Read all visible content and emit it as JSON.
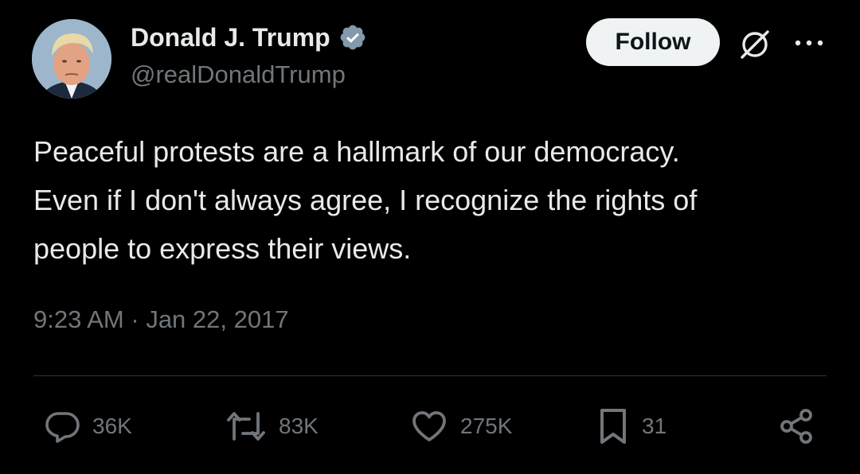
{
  "user": {
    "display_name": "Donald J. Trump",
    "handle": "@realDonaldTrump",
    "verified": true,
    "verified_color": "#829aab"
  },
  "header": {
    "follow_label": "Follow",
    "grok_icon": "grok-icon",
    "more_icon": "more-icon"
  },
  "tweet": {
    "lines": [
      "Peaceful protests are a hallmark of our democracy.",
      "Even if I don't always agree, I recognize the rights of",
      "people to express their views."
    ],
    "time": "9:23 AM",
    "separator": " · ",
    "date": "Jan 22, 2017"
  },
  "actions": {
    "replies": "36K",
    "reposts": "83K",
    "likes": "275K",
    "bookmarks": "31"
  },
  "colors": {
    "background": "#000000",
    "text": "#e7e9ea",
    "muted": "#71767b",
    "divider": "#2f3336",
    "follow_bg": "#eff3f4"
  }
}
